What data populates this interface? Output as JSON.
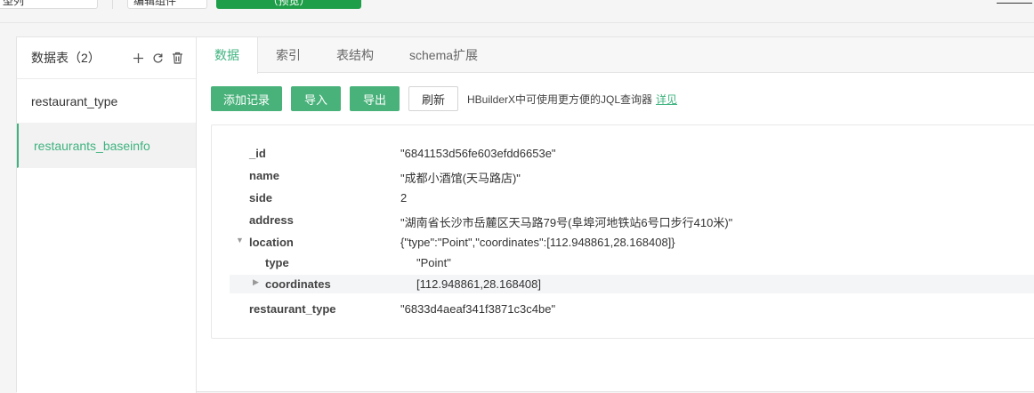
{
  "top": {
    "input_a": "型列",
    "input_b": "编辑组件",
    "green_button": "（预览）"
  },
  "sidebar": {
    "title": "数据表（2）",
    "items": [
      {
        "label": "restaurant_type"
      },
      {
        "label": "restaurants_baseinfo"
      }
    ]
  },
  "tabs": [
    "数据",
    "索引",
    "表结构",
    "schema扩展"
  ],
  "toolbar": {
    "add": "添加记录",
    "import": "导入",
    "export": "导出",
    "refresh": "刷新",
    "hint": "HBuilderX中可使用更方便的JQL查询器",
    "hint_link": "详见"
  },
  "record": {
    "id_key": "_id",
    "id_val": "\"6841153d56fe603efdd6653e\"",
    "name_key": "name",
    "name_val": "\"成都小酒馆(天马路店)\"",
    "side_key": "side",
    "side_val": "2",
    "address_key": "address",
    "address_val": "\"湖南省长沙市岳麓区天马路79号(阜埠河地铁站6号口步行410米)\"",
    "location_key": "location",
    "location_val": "{\"type\":\"Point\",\"coordinates\":[112.948861,28.168408]}",
    "type_key": "type",
    "type_val": "\"Point\"",
    "coordinates_key": "coordinates",
    "coordinates_val": "[112.948861,28.168408]",
    "rtype_key": "restaurant_type",
    "rtype_val": "\"6833d4aeaf341f3871c3c4be\""
  },
  "colors": {
    "accent": "#3fb37f",
    "button_green": "#48b27a"
  },
  "icons": [
    "plus-icon",
    "refresh-icon",
    "trash-icon",
    "caret-down-icon",
    "caret-right-icon"
  ]
}
